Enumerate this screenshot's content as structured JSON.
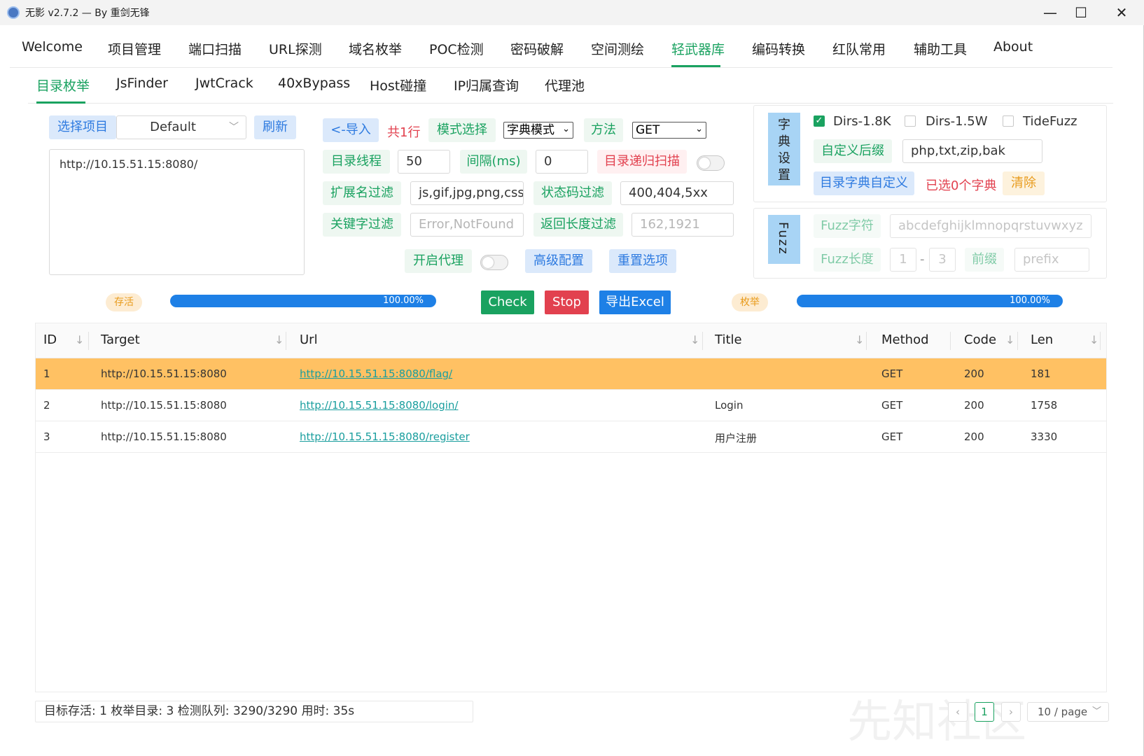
{
  "window": {
    "title": "无影 v2.7.2 — By 重剑无锋",
    "minimize": "—",
    "maximize": "☐",
    "close": "✕"
  },
  "top_tabs": [
    "Welcome",
    "项目管理",
    "端口扫描",
    "URL探测",
    "域名枚举",
    "POC检测",
    "密码破解",
    "空间测绘",
    "轻武器库",
    "编码转换",
    "红队常用",
    "辅助工具",
    "About"
  ],
  "sub_tabs": [
    "目录枚举",
    "JsFinder",
    "JwtCrack",
    "40xBypass",
    "Host碰撞",
    "IP归属查询",
    "代理池"
  ],
  "project": {
    "label": "选择项目",
    "value": "Default",
    "refresh": "刷新"
  },
  "targets_text": "http://10.15.51.15:8080/",
  "import": {
    "button": "<-导入",
    "count": "共1行"
  },
  "mode": {
    "label": "模式选择",
    "value": "字典模式"
  },
  "method": {
    "label": "方法",
    "value": "GET"
  },
  "threads": {
    "label": "目录线程",
    "value": "50"
  },
  "interval": {
    "label": "间隔(ms)",
    "value": "0"
  },
  "recursive": {
    "label": "目录递归扫描"
  },
  "ext_filter": {
    "label": "扩展名过滤",
    "value": "js,gif,jpg,png,css"
  },
  "code_filter": {
    "label": "状态码过滤",
    "value": "400,404,5xx"
  },
  "keyword_filter": {
    "label": "关键字过滤",
    "placeholder": "Error,NotFound"
  },
  "length_filter": {
    "label": "返回长度过滤",
    "placeholder": "162,1921"
  },
  "proxy": {
    "label": "开启代理"
  },
  "advanced": "高级配置",
  "reset": "重置选项",
  "dict": {
    "tab": "字典设置",
    "options": [
      {
        "label": "Dirs-1.8K",
        "checked": true
      },
      {
        "label": "Dirs-1.5W",
        "checked": false
      },
      {
        "label": "TideFuzz",
        "checked": false
      }
    ],
    "suffix_label": "自定义后缀",
    "suffix_value": "php,txt,zip,bak",
    "custom_label": "目录字典自定义",
    "selected_text": "已选0个字典",
    "clear": "清除"
  },
  "fuzz": {
    "tab": "Fuzz",
    "chars_label": "Fuzz字符",
    "chars_placeholder": "abcdefghijklmnopqrstuvwxyz",
    "len_label": "Fuzz长度",
    "len_min": "1",
    "len_sep": "-",
    "len_max": "3",
    "prefix_label": "前缀",
    "prefix_placeholder": "prefix"
  },
  "alive": {
    "label": "存活",
    "progress_text": "100.00%",
    "progress": 1.0
  },
  "enum": {
    "label": "枚举",
    "progress_text": "100.00%",
    "progress": 1.0
  },
  "actions": {
    "check": "Check",
    "stop": "Stop",
    "export": "导出Excel"
  },
  "table": {
    "columns": [
      "ID",
      "Target",
      "Url",
      "Title",
      "Method",
      "Code",
      "Len"
    ],
    "rows": [
      {
        "id": "1",
        "target": "http://10.15.51.15:8080",
        "url": "http://10.15.51.15:8080/flag/",
        "title": "",
        "method": "GET",
        "code": "200",
        "len": "181"
      },
      {
        "id": "2",
        "target": "http://10.15.51.15:8080",
        "url": "http://10.15.51.15:8080/login/",
        "title": "Login",
        "method": "GET",
        "code": "200",
        "len": "1758"
      },
      {
        "id": "3",
        "target": "http://10.15.51.15:8080",
        "url": "http://10.15.51.15:8080/register",
        "title": "用户注册",
        "method": "GET",
        "code": "200",
        "len": "3330"
      }
    ]
  },
  "status_text": "目标存活: 1   枚举目录: 3   检测队列: 3290/3290   用时: 35s",
  "pagination": {
    "prev": "‹",
    "page": "1",
    "next": "›",
    "page_size": "10 / page"
  },
  "watermark": "先知社区",
  "colors": {
    "accent": "#1aa260",
    "link": "#1a9e9e",
    "highlight_row": "#ffc163",
    "progress": "#1e80e6",
    "danger": "#e2414f"
  }
}
